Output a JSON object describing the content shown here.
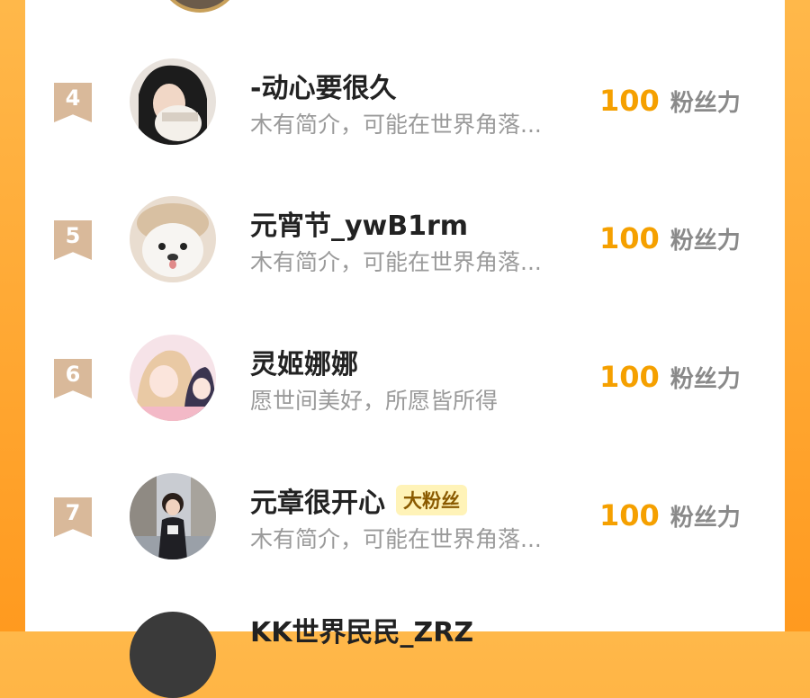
{
  "rows": [
    {
      "rank": "4",
      "name": "-动心要很久",
      "badge": "",
      "bio": "木有简介，可能在世界角落...",
      "score": "100",
      "score_label": "粉丝力",
      "avatar": "girl-covering-face"
    },
    {
      "rank": "5",
      "name": "元宵节_ywB1rm",
      "badge": "",
      "bio": "木有简介，可能在世界角落...",
      "score": "100",
      "score_label": "粉丝力",
      "avatar": "white-puppy"
    },
    {
      "rank": "6",
      "name": "灵姬娜娜",
      "badge": "",
      "bio": "愿世间美好，所愿皆所得",
      "score": "100",
      "score_label": "粉丝力",
      "avatar": "anime-girls"
    },
    {
      "rank": "7",
      "name": "元章很开心",
      "badge": "大粉丝",
      "bio": "木有简介，可能在世界角落...",
      "score": "100",
      "score_label": "粉丝力",
      "avatar": "girl-street-photo"
    }
  ],
  "partial_row": {
    "name": "KK世界民民_ZRZ"
  },
  "colors": {
    "accent": "#f5a000",
    "rank_badge": "#d9b99a",
    "background": "#ff9a1f"
  }
}
